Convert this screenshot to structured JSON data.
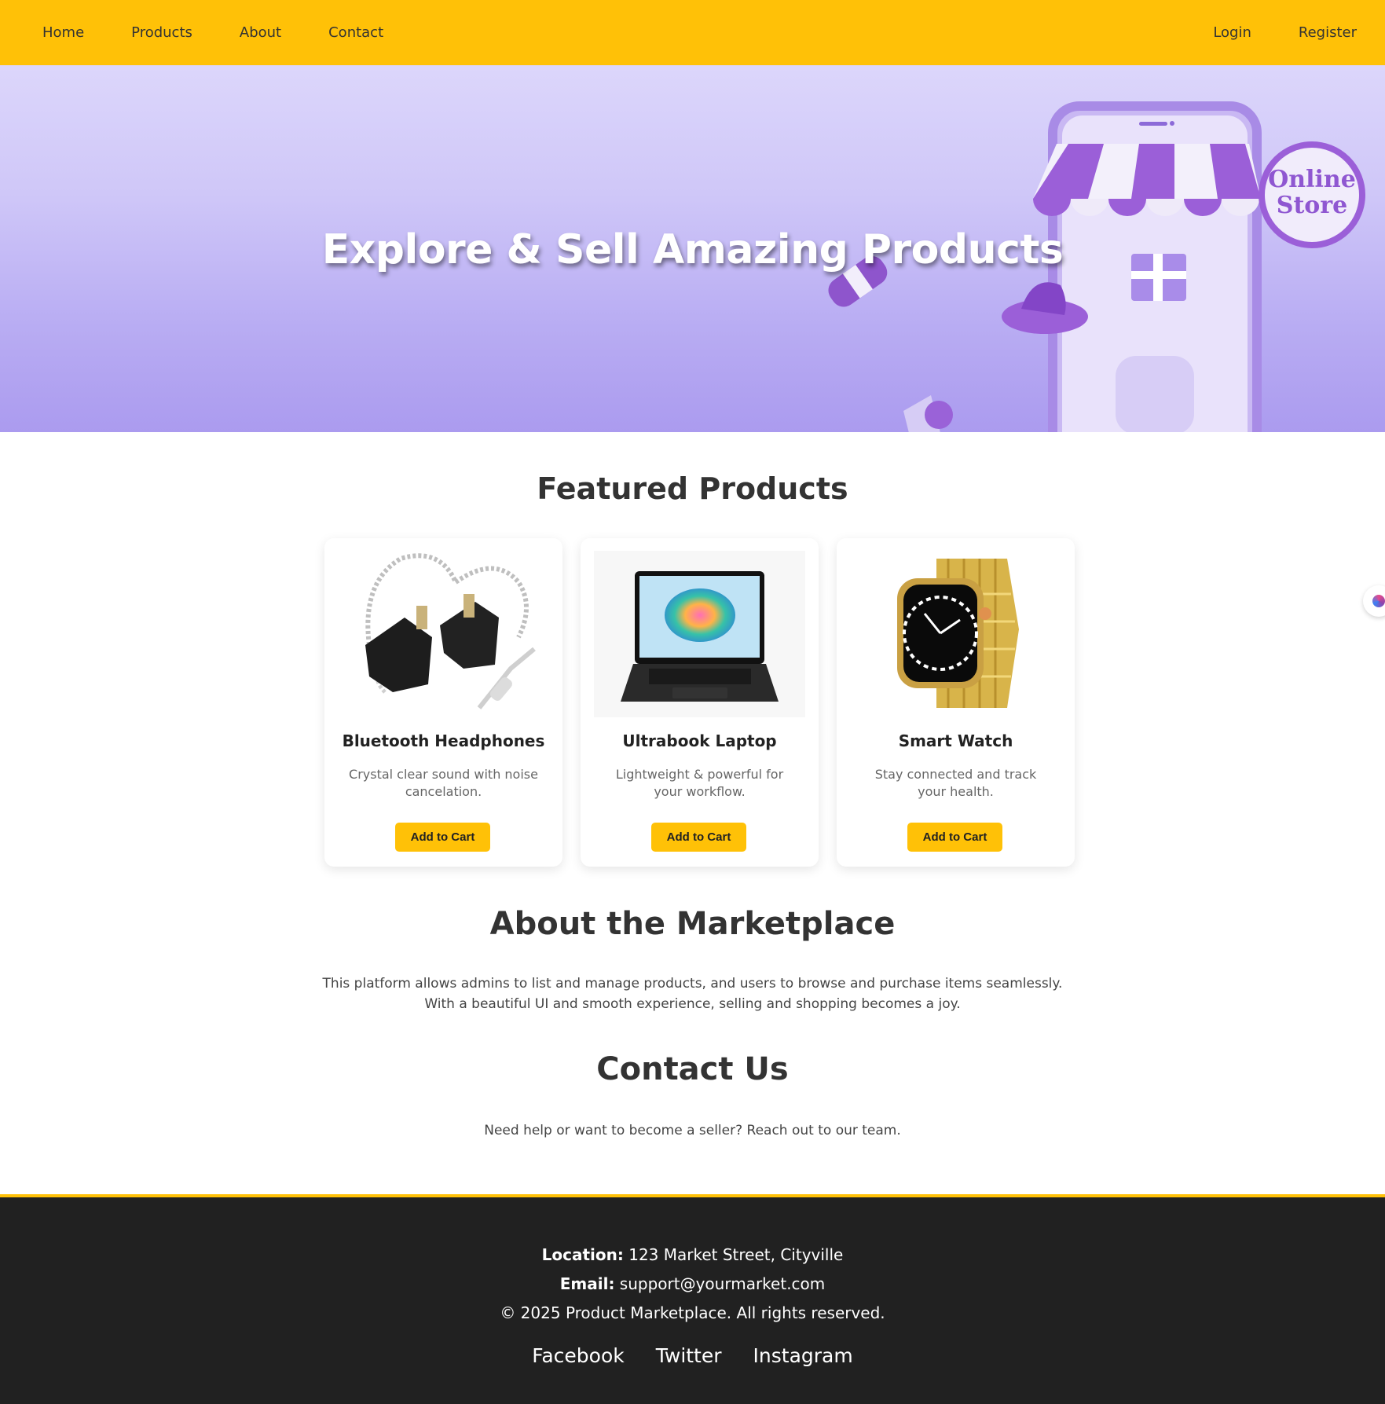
{
  "nav": {
    "left": [
      "Home",
      "Products",
      "About",
      "Contact"
    ],
    "right": [
      "Login",
      "Register"
    ]
  },
  "hero": {
    "title": "Explore & Sell Amazing Products",
    "sign_text": [
      "Online",
      "Store"
    ]
  },
  "featured": {
    "title": "Featured Products",
    "products": [
      {
        "name": "Bluetooth Headphones",
        "desc": "Crystal clear sound with noise cancelation.",
        "button": "Add to Cart"
      },
      {
        "name": "Ultrabook Laptop",
        "desc": "Lightweight & powerful for your workflow.",
        "button": "Add to Cart"
      },
      {
        "name": "Smart Watch",
        "desc": "Stay connected and track your health.",
        "button": "Add to Cart"
      }
    ]
  },
  "about": {
    "title": "About the Marketplace",
    "lines": [
      "This platform allows admins to list and manage products, and users to browse and purchase items seamlessly.",
      "With a beautiful UI and smooth experience, selling and shopping becomes a joy."
    ]
  },
  "contact": {
    "title": "Contact Us",
    "text": "Need help or want to become a seller? Reach out to our team."
  },
  "footer": {
    "location_label": "Location:",
    "location": " 123 Market Street, Cityville",
    "email_label": "Email:",
    "email": " support@yourmarket.com",
    "copyright": "© 2025 Product Marketplace. All rights reserved.",
    "socials": [
      "Facebook",
      "Twitter",
      "Instagram"
    ]
  },
  "colors": {
    "accent": "#FFC107",
    "footer_bg": "#212121",
    "hero_purple": "#b9adf3"
  }
}
